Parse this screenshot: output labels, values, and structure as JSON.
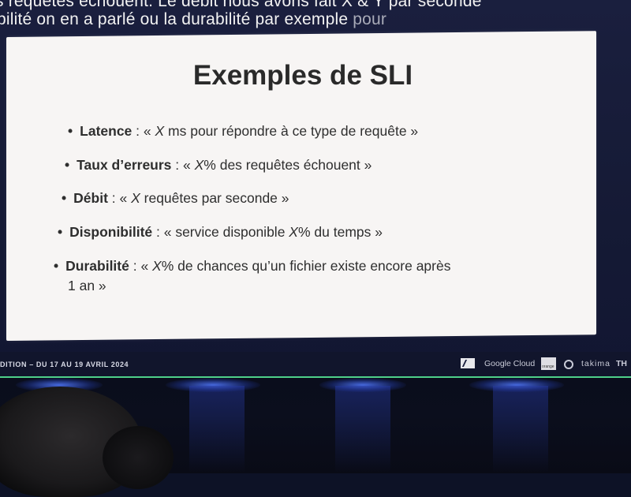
{
  "subtitles": {
    "line1": "s requêtes échouent. Le débit nous avons fait X & Y par seconde",
    "line2_main": "bilité on en a parlé ou la durabilité par exemple",
    "line2_dim": " pour"
  },
  "slide": {
    "title": "Exemples de SLI",
    "bullets": [
      {
        "term": "Latence",
        "sep": " : « ",
        "x": "X",
        "rest": " ms pour répondre à ce type de requête »"
      },
      {
        "term": "Taux d’erreurs",
        "sep": " : « ",
        "x": "X",
        "rest": "% des requêtes échouent »"
      },
      {
        "term": "Débit",
        "sep": " : « ",
        "x": "X",
        "rest": " requêtes par seconde »"
      },
      {
        "term": "Disponibilité",
        "sep": " : « service disponible ",
        "x": "X",
        "rest": "% du temps »"
      },
      {
        "term": "Durabilité",
        "sep": " : « ",
        "x": "X",
        "rest": "% de chances qu’un fichier existe encore après",
        "cont": "1 an »"
      }
    ]
  },
  "footer": {
    "event_text": "DITION – DU 17 AU 19 AVRIL 2024",
    "sponsors": [
      "Google Cloud",
      "orange",
      "takima",
      "TH"
    ]
  },
  "icons": [
    "axa-logo-icon",
    "orange-logo-icon",
    "takima-logo-icon"
  ],
  "colors": {
    "slide_bg": "#f7f5f4",
    "screen_bg": "#151a35",
    "accent_line": "#4fd08a",
    "stage_light": "#4f78ff"
  }
}
